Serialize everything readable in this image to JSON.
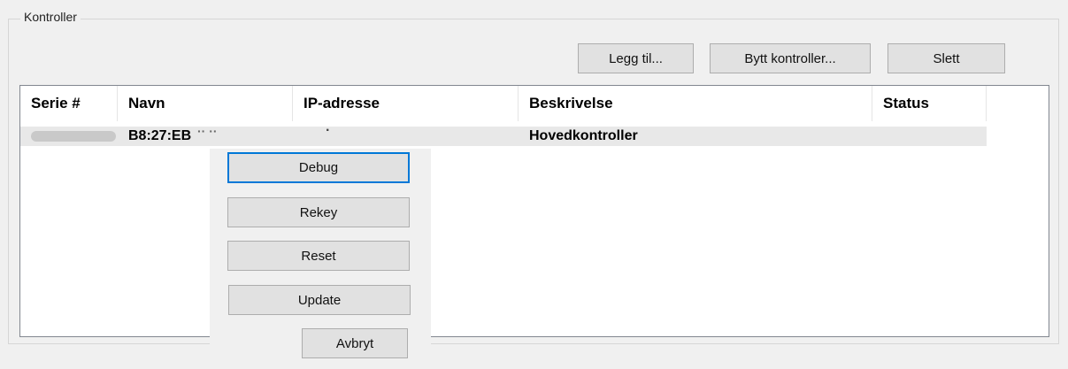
{
  "group": {
    "title": "Kontroller"
  },
  "toolbar": {
    "add_label": "Legg til...",
    "swap_label": "Bytt kontroller...",
    "delete_label": "Slett"
  },
  "table": {
    "columns": [
      "Serie #",
      "Navn",
      "IP-adresse",
      "Beskrivelse",
      "Status"
    ],
    "rows": [
      {
        "serial": "",
        "name": "B8:27:EB",
        "name_redacted": "·· ··",
        "ip": "·",
        "description": "Hovedkontroller",
        "status": ""
      }
    ]
  },
  "popup": {
    "debug_label": "Debug",
    "rekey_label": "Rekey",
    "reset_label": "Reset",
    "update_label": "Update",
    "cancel_label": "Avbryt"
  }
}
